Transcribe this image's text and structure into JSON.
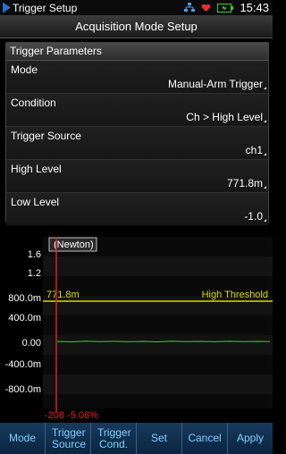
{
  "statusbar": {
    "title": "Trigger Setup",
    "time": "15:43"
  },
  "header": {
    "title": "Acquisition Mode Setup"
  },
  "panel": {
    "title": "Trigger Parameters",
    "params": [
      {
        "label": "Mode",
        "value": "Manual-Arm Trigger"
      },
      {
        "label": "Condition",
        "value": "Ch > High Level"
      },
      {
        "label": "Trigger Source",
        "value": "ch1"
      },
      {
        "label": "High Level",
        "value": "771.8m"
      },
      {
        "label": "Low Level",
        "value": "-1.0"
      }
    ]
  },
  "scope": {
    "channel_label": "(Newton)",
    "y_ticks": [
      "1.6",
      "1.2",
      "800.0m",
      "400.0m",
      "0.00",
      "-400.0m",
      "-800.0m"
    ],
    "threshold_value": "771.8m",
    "threshold_label": "High Threshold",
    "cursor_readout": "-208 -5.08%"
  },
  "toolbar": {
    "buttons": [
      {
        "label": "Mode"
      },
      {
        "label": "Trigger Source"
      },
      {
        "label": "Trigger Cond."
      },
      {
        "label": "Set"
      },
      {
        "label": "Cancel"
      },
      {
        "label": "Apply"
      }
    ]
  },
  "colors": {
    "threshold": "#d8d800",
    "trace": "#2fd62f",
    "cursor": "#e02020",
    "toolbar_text": "#7fd0ff"
  }
}
